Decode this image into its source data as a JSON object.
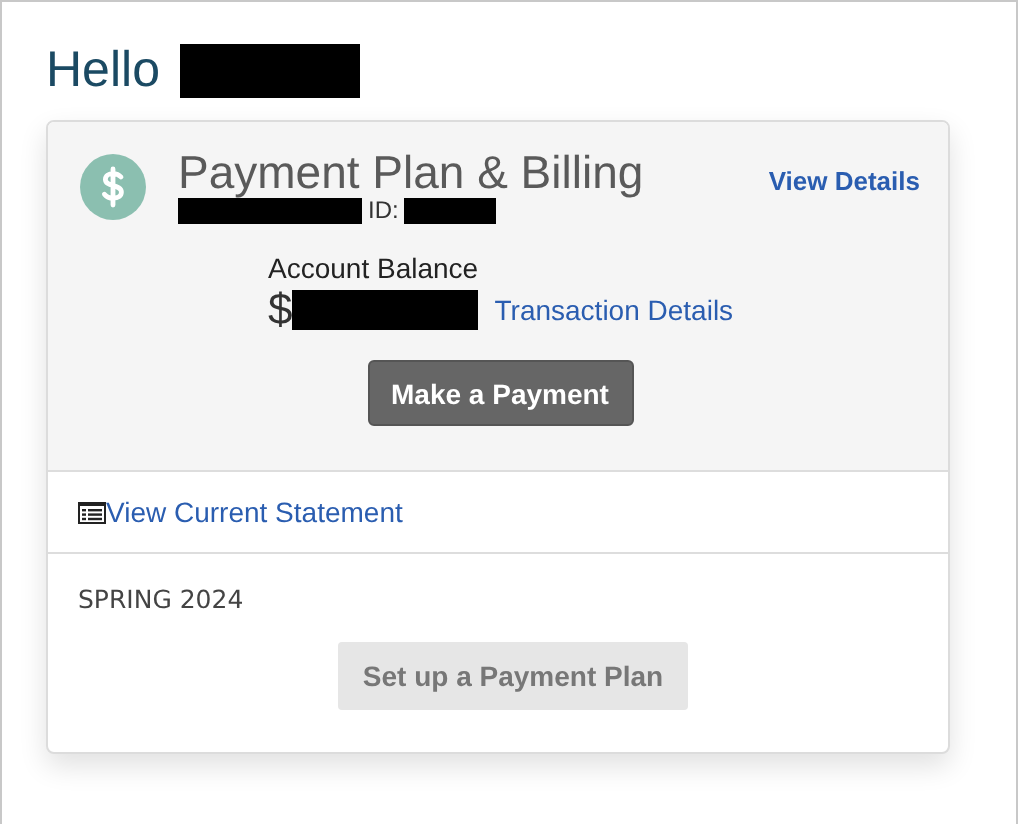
{
  "greeting": "Hello",
  "card": {
    "title": "Payment Plan & Billing",
    "id_label": "ID:",
    "view_details": "View Details",
    "balance_label": "Account Balance",
    "currency": "$",
    "transaction_link": "Transaction Details",
    "pay_button": "Make a Payment"
  },
  "statement_link": "View Current Statement",
  "term": {
    "name": "SPRING 2024",
    "plan_button": {
      "label": "Set up a Payment Plan",
      "disabled": true
    }
  }
}
